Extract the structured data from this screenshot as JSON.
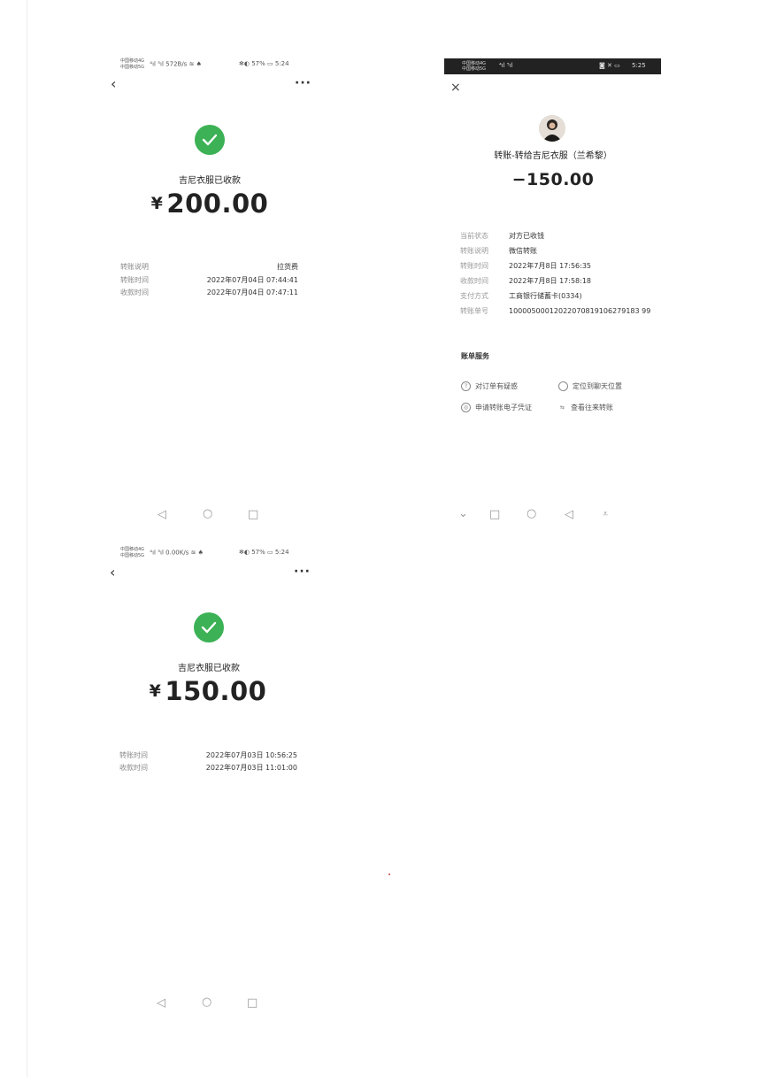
{
  "screen1": {
    "status": {
      "carrier_line1": "中国移动4G",
      "carrier_line2": "中国移动5G",
      "speed": "572B/s",
      "battery": "57%",
      "time": "5:24"
    },
    "back_icon": "chevron-left-icon",
    "more_label": "···",
    "success_icon": "check-circle-icon",
    "title": "吉尼衣服已收款",
    "currency": "¥",
    "amount": "200.00",
    "details": [
      {
        "label": "转账说明",
        "value": "拉货费"
      },
      {
        "label": "转账时间",
        "value": "2022年07月04日 07:44:41"
      },
      {
        "label": "收款时间",
        "value": "2022年07月04日 07:47:11"
      }
    ],
    "nav": {
      "back": "◁",
      "home": "○",
      "recent": "□"
    }
  },
  "screen2": {
    "status": {
      "carrier_line1": "中国移动4G",
      "carrier_line2": "中国移动5G",
      "time": "5:25"
    },
    "close_label": "×",
    "title": "转账-转给吉尼衣服（兰希黎）",
    "amount": "−150.00",
    "details": [
      {
        "label": "当前状态",
        "value": "对方已收钱"
      },
      {
        "label": "转账说明",
        "value": "微信转账"
      },
      {
        "label": "转账时间",
        "value": "2022年7月8日 17:56:35"
      },
      {
        "label": "收款时间",
        "value": "2022年7月8日 17:58:18"
      },
      {
        "label": "支付方式",
        "value": "工商银行储蓄卡(0334)"
      },
      {
        "label": "转账单号",
        "value": "10000500012022070819106279183 99"
      }
    ],
    "service_title": "账单服务",
    "services": [
      {
        "icon": "question-circle-icon",
        "glyph": "?",
        "label": "对订单有疑惑"
      },
      {
        "icon": "chat-bubble-icon",
        "glyph": "",
        "label": "定位到聊天位置"
      },
      {
        "icon": "certificate-icon",
        "glyph": "◎",
        "label": "申请转账电子凭证"
      },
      {
        "icon": "swap-icon",
        "glyph": "⇆",
        "label": "查看往来转账"
      }
    ],
    "nav": {
      "down": "⌄",
      "recent": "□",
      "home": "○",
      "back": "◁",
      "dock": "⩡"
    }
  },
  "screen3": {
    "status": {
      "carrier_line1": "中国移动4G",
      "carrier_line2": "中国移动5G",
      "speed": "0.00K/s",
      "battery": "57%",
      "time": "5:24"
    },
    "back_icon": "chevron-left-icon",
    "more_label": "···",
    "success_icon": "check-circle-icon",
    "title": "吉尼衣服已收款",
    "currency": "¥",
    "amount": "150.00",
    "details": [
      {
        "label": "转账时间",
        "value": "2022年07月03日 10:56:25"
      },
      {
        "label": "收款时间",
        "value": "2022年07月03日 11:01:00"
      }
    ],
    "nav": {
      "back": "◁",
      "home": "○",
      "recent": "□"
    }
  }
}
